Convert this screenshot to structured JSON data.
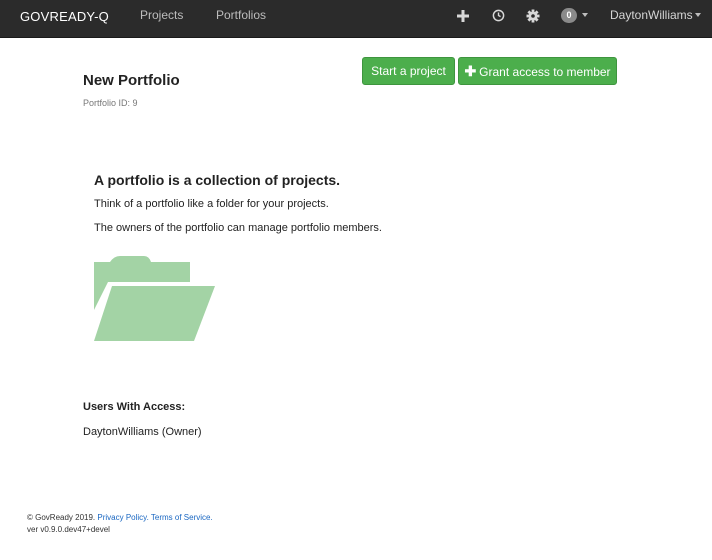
{
  "navbar": {
    "brand": "GOVREADY-Q",
    "links": [
      "Projects",
      "Portfolios"
    ],
    "icons": [
      "plus-icon",
      "clock-icon",
      "gear-icon"
    ],
    "notification_count": "0",
    "user": "DaytonWilliams"
  },
  "page": {
    "title": "New Portfolio",
    "subtitle": "Portfolio ID: 9",
    "buttons": {
      "start_project": "Start a project",
      "grant_access": "Grant access to member"
    }
  },
  "empty_state": {
    "heading": "A portfolio is a collection of projects.",
    "line1": "Think of a portfolio like a folder for your projects.",
    "line2": "The owners of the portfolio can manage portfolio members.",
    "icon": "folder-open-icon",
    "icon_color": "#a3d3a5"
  },
  "access": {
    "heading": "Users With Access:",
    "users": [
      "DaytonWilliams (Owner)"
    ]
  },
  "footer": {
    "copyright": "© GovReady 2019.",
    "privacy": "Privacy Policy.",
    "terms": "Terms of Service.",
    "version": "ver v0.9.0.dev47+devel"
  },
  "colors": {
    "navbar": "#2b2b2b",
    "button_green": "#4cae4c",
    "link_blue": "#1a67c2"
  }
}
